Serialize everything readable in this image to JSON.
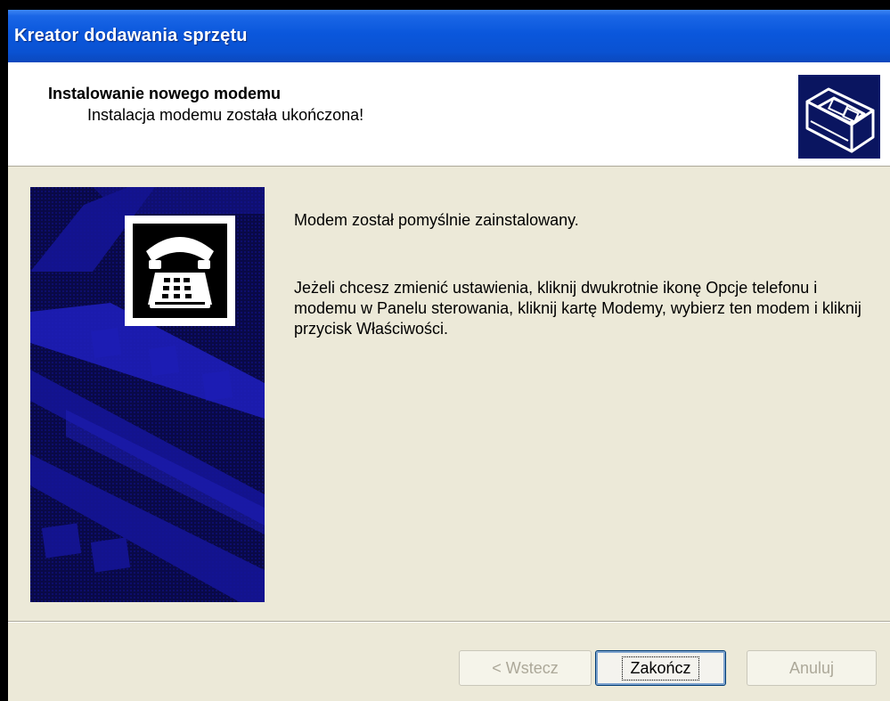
{
  "window": {
    "title": "Kreator dodawania sprzętu"
  },
  "header": {
    "title": "Instalowanie nowego modemu",
    "subtitle": "Instalacja modemu została ukończona!",
    "icon": "hardware-wizard-icon"
  },
  "content": {
    "side_image": "telephone-modem-icon",
    "message": "Modem został pomyślnie zainstalowany.",
    "instructions": "Jeżeli chcesz zmienić ustawienia, kliknij dwukrotnie ikonę Opcje telefonu i modemu w Panelu sterowania, kliknij kartę Modemy, wybierz ten modem i kliknij przycisk Właściwości."
  },
  "buttons": {
    "back_label": "< Wstecz",
    "finish_label": "Zakończ",
    "cancel_label": "Anuluj"
  },
  "colors": {
    "titlebar": "#0a57dc",
    "dialog_bg": "#ece9d8",
    "side_panel": "#0a0a5e"
  }
}
